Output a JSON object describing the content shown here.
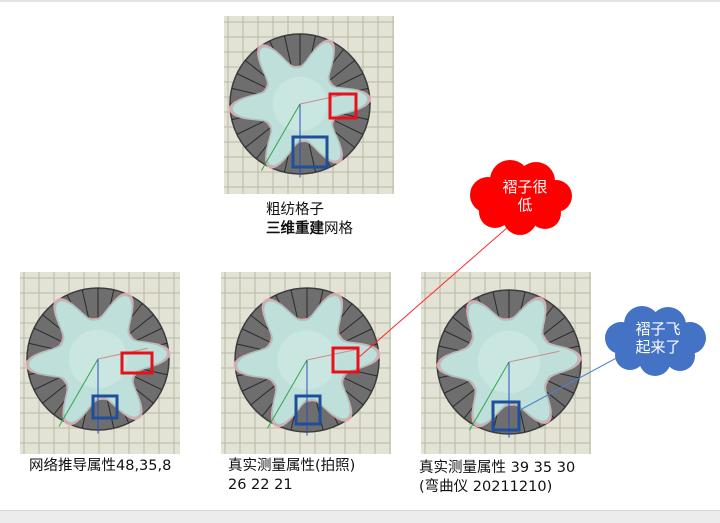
{
  "captions": {
    "top_line1": "粗纺格子",
    "top_line2_bold": "三维重建",
    "top_line2_rest": "网格",
    "left": "网络推导属性48,35,8",
    "mid_line1": "真实测量属性(拍照)",
    "mid_line2": "26 22 21",
    "right_line1": "真实测量属性 39 35 30",
    "right_line2": "(弯曲仪 20211210)"
  },
  "callouts": {
    "red_line1": "褶子很",
    "red_line2": "低",
    "blue_line1": "褶子飞",
    "blue_line2": "起来了"
  },
  "colors": {
    "callout_red": "#ff0000",
    "callout_blue": "#4472c4",
    "box_red": "#e8101a",
    "box_blue": "#1f4e9a",
    "grid_bg": "#e2e3d4",
    "disc": "#6e6e6e",
    "fabric": "#bfe0da"
  }
}
